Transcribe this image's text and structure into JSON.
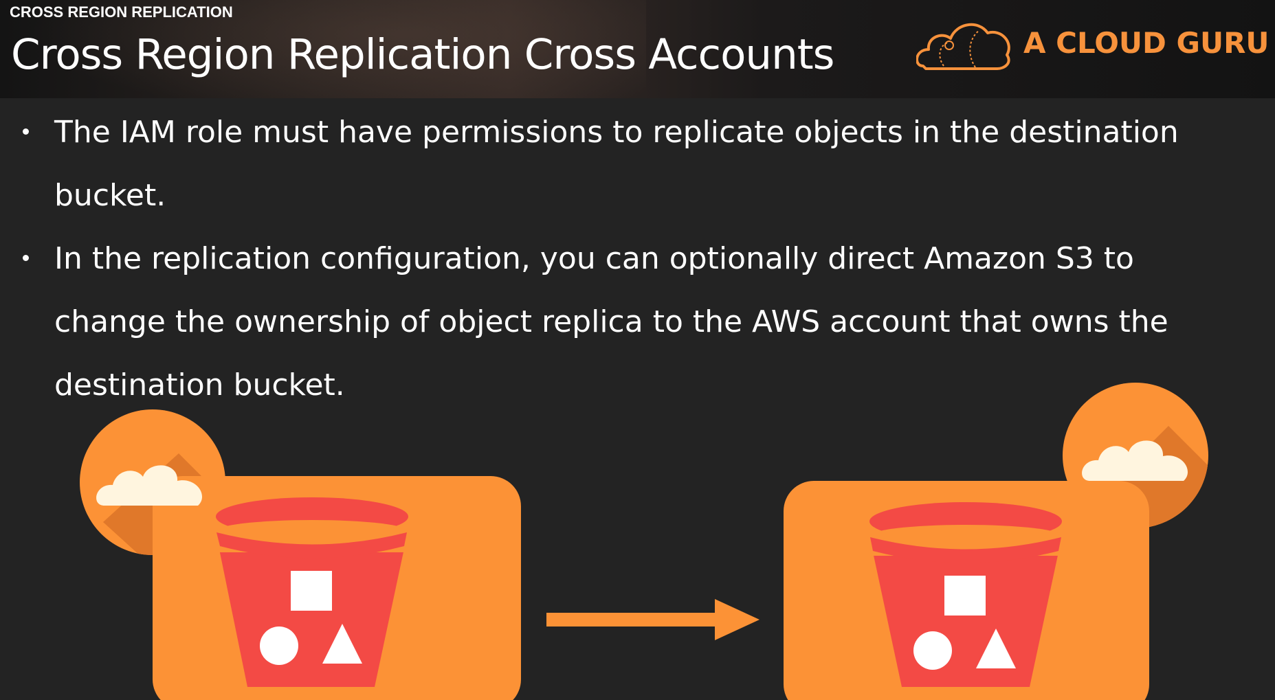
{
  "header": {
    "section_label": "CROSS REGION REPLICATION",
    "title": "Cross Region Replication Cross Accounts",
    "brand_name": "A CLOUD GURU"
  },
  "bullets": [
    "The IAM role must have permissions to replicate objects in the destination bucket.",
    "In the replication configuration, you can optionally direct Amazon S3 to change the ownership of object replica to the AWS account that owns the destination bucket."
  ],
  "diagram": {
    "source_icon": "s3-bucket-icon",
    "destination_icon": "s3-bucket-icon",
    "arrow_icon": "arrow-right-icon"
  },
  "colors": {
    "background": "#232323",
    "brand_orange": "#f7923c",
    "tile_orange": "#fc9236",
    "bucket_red": "#f34a45",
    "cloud_cream": "#fff5df"
  }
}
